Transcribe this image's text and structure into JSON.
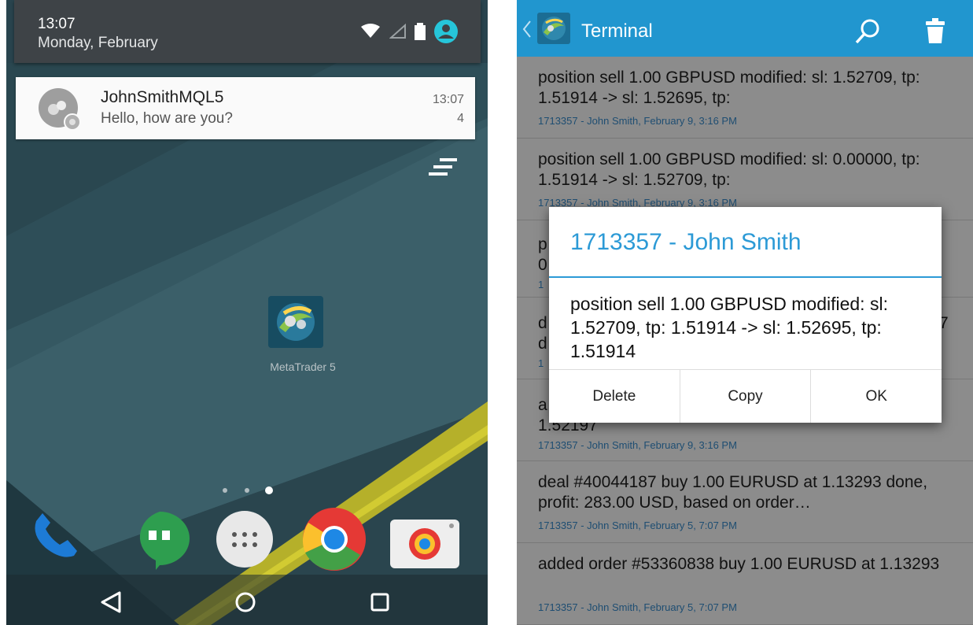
{
  "left_screen": {
    "status": {
      "time": "13:07",
      "date": "Monday, February"
    },
    "notification": {
      "sender": "JohnSmithMQL5",
      "message": "Hello, how are you?",
      "time": "13:07",
      "count": "4"
    },
    "app_icon_label": "MetaTrader 5"
  },
  "right_screen": {
    "title": "Terminal",
    "entries": [
      {
        "text": "position sell 1.00 GBPUSD modified: sl: 1.52709, tp: 1.51914 -> sl: 1.52695, tp:",
        "meta": "1713357 - John Smith, February 9, 3:16 PM"
      },
      {
        "text": "position sell 1.00 GBPUSD modified: sl: 0.00000, tp: 1.51914 -> sl: 1.52709, tp:",
        "meta": "1713357 - John Smith, February 9, 3:16 PM"
      },
      {
        "text": "p",
        "text2": "0",
        "meta": "1"
      },
      {
        "text": "d",
        "text_right": "7",
        "text2": "d",
        "meta": "1"
      },
      {
        "text": "a",
        "text2": "1.52197",
        "meta": "1713357 - John Smith, February 9, 3:16 PM"
      },
      {
        "text": "deal #40044187 buy 1.00 EURUSD at 1.13293 done, profit: 283.00 USD, based on order…",
        "meta": "1713357 - John Smith, February 5, 7:07 PM"
      },
      {
        "text": "added order #53360838 buy 1.00 EURUSD at 1.13293",
        "meta": "1713357 - John Smith, February 5, 7:07 PM"
      }
    ],
    "dialog": {
      "title": "1713357 - John Smith",
      "body": "position sell 1.00 GBPUSD modified: sl: 1.52709, tp: 1.51914 -> sl: 1.52695, tp: 1.51914",
      "buttons": {
        "delete": "Delete",
        "copy": "Copy",
        "ok": "OK"
      }
    }
  },
  "colors": {
    "accent_blue": "#2196cf",
    "dialog_title": "#2c9ad6",
    "meta_blue": "#3a8fd0",
    "status_accent": "#26c6da"
  },
  "icons": [
    "wifi-icon",
    "signal-icon",
    "battery-icon",
    "account-icon",
    "clear-all-icon",
    "phone-icon",
    "hangouts-icon",
    "app-drawer-icon",
    "chrome-icon",
    "camera-icon",
    "back-nav-icon",
    "home-nav-icon",
    "recents-nav-icon",
    "search-icon",
    "trash-icon"
  ]
}
